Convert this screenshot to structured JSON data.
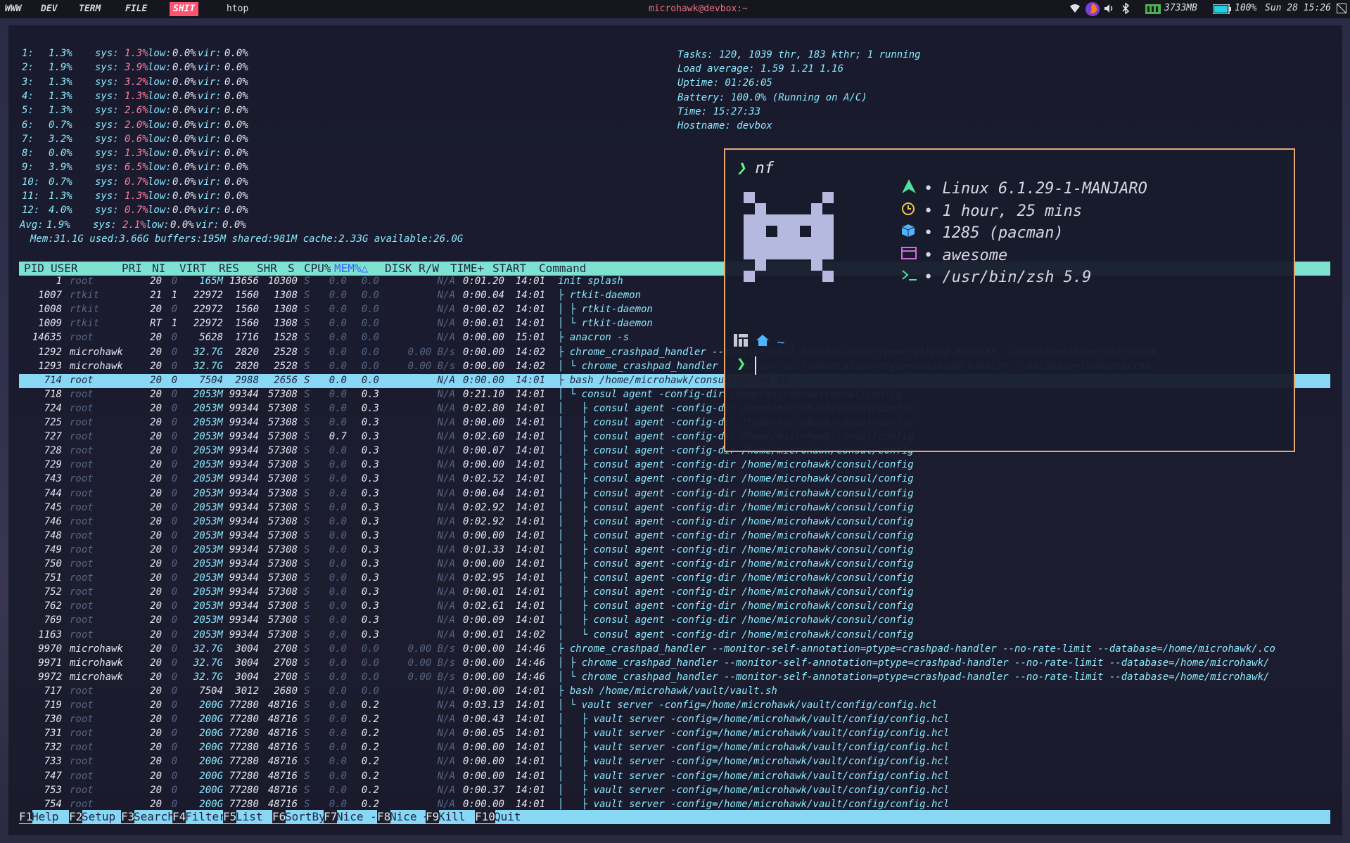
{
  "topbar": {
    "tags": [
      "WWW",
      "DEV",
      "TERM",
      "FILE",
      "SHIT"
    ],
    "app_title": "htop",
    "center_title": "microhawk@devbox:~",
    "mem": "3733MB",
    "battery": "100%",
    "datetime": "Sun 28 15:26"
  },
  "htop": {
    "cpus": [
      {
        "n": "1:",
        "usr": "1.3%",
        "sys": "1.3%",
        "low": "0.0%",
        "vir": "0.0%"
      },
      {
        "n": "2:",
        "usr": "1.9%",
        "sys": "3.9%",
        "low": "0.0%",
        "vir": "0.0%"
      },
      {
        "n": "3:",
        "usr": "1.3%",
        "sys": "3.2%",
        "low": "0.0%",
        "vir": "0.0%"
      },
      {
        "n": "4:",
        "usr": "1.3%",
        "sys": "1.3%",
        "low": "0.0%",
        "vir": "0.0%"
      },
      {
        "n": "5:",
        "usr": "1.3%",
        "sys": "2.6%",
        "low": "0.0%",
        "vir": "0.0%"
      },
      {
        "n": "6:",
        "usr": "0.7%",
        "sys": "2.0%",
        "low": "0.0%",
        "vir": "0.0%"
      },
      {
        "n": "7:",
        "usr": "3.2%",
        "sys": "0.6%",
        "low": "0.0%",
        "vir": "0.0%"
      },
      {
        "n": "8:",
        "usr": "0.0%",
        "sys": "1.3%",
        "low": "0.0%",
        "vir": "0.0%"
      },
      {
        "n": "9:",
        "usr": "3.9%",
        "sys": "6.5%",
        "low": "0.0%",
        "vir": "0.0%"
      },
      {
        "n": "10:",
        "usr": "0.7%",
        "sys": "0.7%",
        "low": "0.0%",
        "vir": "0.0%"
      },
      {
        "n": "11:",
        "usr": "1.3%",
        "sys": "1.3%",
        "low": "0.0%",
        "vir": "0.0%"
      },
      {
        "n": "12:",
        "usr": "4.0%",
        "sys": "0.7%",
        "low": "0.0%",
        "vir": "0.0%"
      },
      {
        "n": "Avg:",
        "usr": "1.9%",
        "sys": "2.1%",
        "low": "0.0%",
        "vir": "0.0%"
      }
    ],
    "labels": {
      "sys": "sys:",
      "low": "low:",
      "vir": "vir:"
    },
    "mem_line": "Mem:31.1G used:3.66G buffers:195M shared:981M cache:2.33G available:26.0G",
    "tasks": "Tasks: 120, 1039 thr, 183 kthr; 1 running",
    "load": "Load average: 1.59 1.21 1.16",
    "uptime": "Uptime: 01:26:05",
    "battery": "Battery: 100.0% (Running on A/C)",
    "time": "Time: 15:27:33",
    "hostname": "Hostname: devbox",
    "columns": [
      "PID",
      "USER",
      "PRI",
      "NI",
      "VIRT",
      "RES",
      "SHR",
      "S",
      "CPU%",
      "MEM%△",
      "DISK R/W",
      "TIME+",
      "START",
      "Command"
    ],
    "processes": [
      [
        "1",
        "root",
        "20",
        "0",
        "165M",
        "13656",
        "10300",
        "S",
        "0.0",
        "0.0",
        "N/A",
        "0:01.20",
        "14:01",
        "init splash"
      ],
      [
        "1007",
        "rtkit",
        "21",
        "1",
        "22972",
        "1560",
        "1308",
        "S",
        "0.0",
        "0.0",
        "N/A",
        "0:00.04",
        "14:01",
        "├ rtkit-daemon"
      ],
      [
        "1008",
        "rtkit",
        "20",
        "0",
        "22972",
        "1560",
        "1308",
        "S",
        "0.0",
        "0.0",
        "N/A",
        "0:00.02",
        "14:01",
        "│ ├ rtkit-daemon"
      ],
      [
        "1009",
        "rtkit",
        "RT",
        "1",
        "22972",
        "1560",
        "1308",
        "S",
        "0.0",
        "0.0",
        "N/A",
        "0:00.01",
        "14:01",
        "│ └ rtkit-daemon"
      ],
      [
        "14635",
        "root",
        "20",
        "0",
        "5628",
        "1716",
        "1528",
        "S",
        "0.0",
        "0.0",
        "N/A",
        "0:00.00",
        "15:01",
        "├ anacron -s"
      ],
      [
        "1292",
        "microhawk",
        "20",
        "0",
        "32.7G",
        "2820",
        "2528",
        "S",
        "0.0",
        "0.0",
        "0.00 B/s",
        "0:00.00",
        "14:02",
        "├ chrome_crashpad_handler --monitor-self-annotation=ptype=crashpad-handler --database=/home/microhawk"
      ],
      [
        "1293",
        "microhawk",
        "20",
        "0",
        "32.7G",
        "2820",
        "2528",
        "S",
        "0.0",
        "0.0",
        "0.00 B/s",
        "0:00.00",
        "14:02",
        "│ └ chrome_crashpad_handler --monitor-self-annotation=ptype=crashpad-handler --database=/home/microh"
      ],
      [
        "714",
        "root",
        "20",
        "0",
        "7504",
        "2988",
        "2656",
        "S",
        "0.0",
        "0.0",
        "N/A",
        "0:00.00",
        "14:01",
        "├ bash /home/microhawk/consul/consul.sh"
      ],
      [
        "718",
        "root",
        "20",
        "0",
        "2053M",
        "99344",
        "57308",
        "S",
        "0.0",
        "0.3",
        "N/A",
        "0:21.10",
        "14:01",
        "│ └ consul agent -config-dir /home/microhawk/consul/config"
      ],
      [
        "724",
        "root",
        "20",
        "0",
        "2053M",
        "99344",
        "57308",
        "S",
        "0.0",
        "0.3",
        "N/A",
        "0:02.80",
        "14:01",
        "│   ├ consul agent -config-dir /home/microhawk/consul/config"
      ],
      [
        "725",
        "root",
        "20",
        "0",
        "2053M",
        "99344",
        "57308",
        "S",
        "0.0",
        "0.3",
        "N/A",
        "0:00.00",
        "14:01",
        "│   ├ consul agent -config-dir /home/microhawk/consul/config"
      ],
      [
        "727",
        "root",
        "20",
        "0",
        "2053M",
        "99344",
        "57308",
        "S",
        "0.7",
        "0.3",
        "N/A",
        "0:02.60",
        "14:01",
        "│   ├ consul agent -config-dir /home/microhawk/consul/config"
      ],
      [
        "728",
        "root",
        "20",
        "0",
        "2053M",
        "99344",
        "57308",
        "S",
        "0.0",
        "0.3",
        "N/A",
        "0:00.07",
        "14:01",
        "│   ├ consul agent -config-dir /home/microhawk/consul/config"
      ],
      [
        "729",
        "root",
        "20",
        "0",
        "2053M",
        "99344",
        "57308",
        "S",
        "0.0",
        "0.3",
        "N/A",
        "0:00.00",
        "14:01",
        "│   ├ consul agent -config-dir /home/microhawk/consul/config"
      ],
      [
        "743",
        "root",
        "20",
        "0",
        "2053M",
        "99344",
        "57308",
        "S",
        "0.0",
        "0.3",
        "N/A",
        "0:02.52",
        "14:01",
        "│   ├ consul agent -config-dir /home/microhawk/consul/config"
      ],
      [
        "744",
        "root",
        "20",
        "0",
        "2053M",
        "99344",
        "57308",
        "S",
        "0.0",
        "0.3",
        "N/A",
        "0:00.04",
        "14:01",
        "│   ├ consul agent -config-dir /home/microhawk/consul/config"
      ],
      [
        "745",
        "root",
        "20",
        "0",
        "2053M",
        "99344",
        "57308",
        "S",
        "0.0",
        "0.3",
        "N/A",
        "0:02.92",
        "14:01",
        "│   ├ consul agent -config-dir /home/microhawk/consul/config"
      ],
      [
        "746",
        "root",
        "20",
        "0",
        "2053M",
        "99344",
        "57308",
        "S",
        "0.0",
        "0.3",
        "N/A",
        "0:02.92",
        "14:01",
        "│   ├ consul agent -config-dir /home/microhawk/consul/config"
      ],
      [
        "748",
        "root",
        "20",
        "0",
        "2053M",
        "99344",
        "57308",
        "S",
        "0.0",
        "0.3",
        "N/A",
        "0:00.00",
        "14:01",
        "│   ├ consul agent -config-dir /home/microhawk/consul/config"
      ],
      [
        "749",
        "root",
        "20",
        "0",
        "2053M",
        "99344",
        "57308",
        "S",
        "0.0",
        "0.3",
        "N/A",
        "0:01.33",
        "14:01",
        "│   ├ consul agent -config-dir /home/microhawk/consul/config"
      ],
      [
        "750",
        "root",
        "20",
        "0",
        "2053M",
        "99344",
        "57308",
        "S",
        "0.0",
        "0.3",
        "N/A",
        "0:00.00",
        "14:01",
        "│   ├ consul agent -config-dir /home/microhawk/consul/config"
      ],
      [
        "751",
        "root",
        "20",
        "0",
        "2053M",
        "99344",
        "57308",
        "S",
        "0.0",
        "0.3",
        "N/A",
        "0:02.95",
        "14:01",
        "│   ├ consul agent -config-dir /home/microhawk/consul/config"
      ],
      [
        "752",
        "root",
        "20",
        "0",
        "2053M",
        "99344",
        "57308",
        "S",
        "0.0",
        "0.3",
        "N/A",
        "0:00.01",
        "14:01",
        "│   ├ consul agent -config-dir /home/microhawk/consul/config"
      ],
      [
        "762",
        "root",
        "20",
        "0",
        "2053M",
        "99344",
        "57308",
        "S",
        "0.0",
        "0.3",
        "N/A",
        "0:02.61",
        "14:01",
        "│   ├ consul agent -config-dir /home/microhawk/consul/config"
      ],
      [
        "769",
        "root",
        "20",
        "0",
        "2053M",
        "99344",
        "57308",
        "S",
        "0.0",
        "0.3",
        "N/A",
        "0:00.09",
        "14:01",
        "│   ├ consul agent -config-dir /home/microhawk/consul/config"
      ],
      [
        "1163",
        "root",
        "20",
        "0",
        "2053M",
        "99344",
        "57308",
        "S",
        "0.0",
        "0.3",
        "N/A",
        "0:00.01",
        "14:02",
        "│   └ consul agent -config-dir /home/microhawk/consul/config"
      ],
      [
        "9970",
        "microhawk",
        "20",
        "0",
        "32.7G",
        "3004",
        "2708",
        "S",
        "0.0",
        "0.0",
        "0.00 B/s",
        "0:00.00",
        "14:46",
        "├ chrome_crashpad_handler --monitor-self-annotation=ptype=crashpad-handler --no-rate-limit --database=/home/microhawk/.co"
      ],
      [
        "9971",
        "microhawk",
        "20",
        "0",
        "32.7G",
        "3004",
        "2708",
        "S",
        "0.0",
        "0.0",
        "0.00 B/s",
        "0:00.00",
        "14:46",
        "│ ├ chrome_crashpad_handler --monitor-self-annotation=ptype=crashpad-handler --no-rate-limit --database=/home/microhawk/"
      ],
      [
        "9972",
        "microhawk",
        "20",
        "0",
        "32.7G",
        "3004",
        "2708",
        "S",
        "0.0",
        "0.0",
        "0.00 B/s",
        "0:00.00",
        "14:46",
        "│ └ chrome_crashpad_handler --monitor-self-annotation=ptype=crashpad-handler --no-rate-limit --database=/home/microhawk/"
      ],
      [
        "717",
        "root",
        "20",
        "0",
        "7504",
        "3012",
        "2680",
        "S",
        "0.0",
        "0.0",
        "N/A",
        "0:00.00",
        "14:01",
        "├ bash /home/microhawk/vault/vault.sh"
      ],
      [
        "719",
        "root",
        "20",
        "0",
        "200G",
        "77280",
        "48716",
        "S",
        "0.0",
        "0.2",
        "N/A",
        "0:03.13",
        "14:01",
        "│ └ vault server -config=/home/microhawk/vault/config/config.hcl"
      ],
      [
        "730",
        "root",
        "20",
        "0",
        "200G",
        "77280",
        "48716",
        "S",
        "0.0",
        "0.2",
        "N/A",
        "0:00.43",
        "14:01",
        "│   ├ vault server -config=/home/microhawk/vault/config/config.hcl"
      ],
      [
        "731",
        "root",
        "20",
        "0",
        "200G",
        "77280",
        "48716",
        "S",
        "0.0",
        "0.2",
        "N/A",
        "0:00.05",
        "14:01",
        "│   ├ vault server -config=/home/microhawk/vault/config/config.hcl"
      ],
      [
        "732",
        "root",
        "20",
        "0",
        "200G",
        "77280",
        "48716",
        "S",
        "0.0",
        "0.2",
        "N/A",
        "0:00.00",
        "14:01",
        "│   ├ vault server -config=/home/microhawk/vault/config/config.hcl"
      ],
      [
        "733",
        "root",
        "20",
        "0",
        "200G",
        "77280",
        "48716",
        "S",
        "0.0",
        "0.2",
        "N/A",
        "0:00.00",
        "14:01",
        "│   ├ vault server -config=/home/microhawk/vault/config/config.hcl"
      ],
      [
        "747",
        "root",
        "20",
        "0",
        "200G",
        "77280",
        "48716",
        "S",
        "0.0",
        "0.2",
        "N/A",
        "0:00.00",
        "14:01",
        "│   ├ vault server -config=/home/microhawk/vault/config/config.hcl"
      ],
      [
        "753",
        "root",
        "20",
        "0",
        "200G",
        "77280",
        "48716",
        "S",
        "0.0",
        "0.2",
        "N/A",
        "0:00.37",
        "14:01",
        "│   ├ vault server -config=/home/microhawk/vault/config/config.hcl"
      ],
      [
        "754",
        "root",
        "20",
        "0",
        "200G",
        "77280",
        "48716",
        "S",
        "0.0",
        "0.2",
        "N/A",
        "0:00.00",
        "14:01",
        "│   ├ vault server -config=/home/microhawk/vault/config/config.hcl"
      ]
    ],
    "selected_pid": "714",
    "footer": [
      {
        "key": "F1",
        "label": "Help"
      },
      {
        "key": "F2",
        "label": "Setup"
      },
      {
        "key": "F3",
        "label": "Search"
      },
      {
        "key": "F4",
        "label": "Filter"
      },
      {
        "key": "F5",
        "label": "List"
      },
      {
        "key": "F6",
        "label": "SortBy"
      },
      {
        "key": "F7",
        "label": "Nice -"
      },
      {
        "key": "F8",
        "label": "Nice +"
      },
      {
        "key": "F9",
        "label": "Kill"
      },
      {
        "key": "F10",
        "label": "Quit"
      }
    ]
  },
  "nf": {
    "prompt_cmd": "nf",
    "prompt_symbol": "❯",
    "info": [
      {
        "icon": "arch-icon",
        "text": "•  Linux 6.1.29-1-MANJARO"
      },
      {
        "icon": "clock-icon",
        "text": "•  1 hour, 25 mins"
      },
      {
        "icon": "package-icon",
        "text": "•  1285 (pacman)"
      },
      {
        "icon": "window-icon",
        "text": "•  awesome"
      },
      {
        "icon": "terminal-icon",
        "text": "•  /usr/bin/zsh 5.9"
      }
    ],
    "path": "~"
  },
  "colors": {
    "header_bg": "#7de3d0",
    "selected_bg": "#87d7f5",
    "border": "#e8a970",
    "accent": "#50fa7b"
  }
}
